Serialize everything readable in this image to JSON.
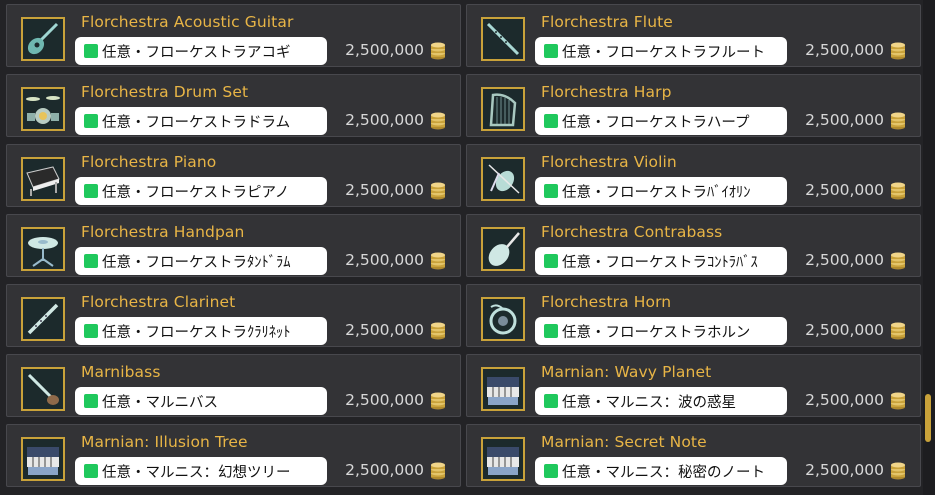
{
  "items": [
    {
      "title": "Florchestra Acoustic Guitar",
      "tag": "任意・フローケストラアコギ",
      "price": "2,500,000",
      "icon": "acoustic-guitar-icon"
    },
    {
      "title": "Florchestra Flute",
      "tag": "任意・フローケストラフルート",
      "price": "2,500,000",
      "icon": "flute-icon"
    },
    {
      "title": "Florchestra Drum Set",
      "tag": "任意・フローケストラドラム",
      "price": "2,500,000",
      "icon": "drum-set-icon"
    },
    {
      "title": "Florchestra Harp",
      "tag": "任意・フローケストラハープ",
      "price": "2,500,000",
      "icon": "harp-icon"
    },
    {
      "title": "Florchestra Piano",
      "tag": "任意・フローケストラピアノ",
      "price": "2,500,000",
      "icon": "piano-icon"
    },
    {
      "title": "Florchestra Violin",
      "tag": "任意・フローケストラﾊﾞｲｵﾘﾝ",
      "price": "2,500,000",
      "icon": "violin-icon"
    },
    {
      "title": "Florchestra Handpan",
      "tag": "任意・フローケストラﾀﾝﾄﾞﾗﾑ",
      "price": "2,500,000",
      "icon": "handpan-icon"
    },
    {
      "title": "Florchestra Contrabass",
      "tag": "任意・フローケストラｺﾝﾄﾗﾊﾞｽ",
      "price": "2,500,000",
      "icon": "contrabass-icon"
    },
    {
      "title": "Florchestra Clarinet",
      "tag": "任意・フローケストラｸﾗﾘﾈｯﾄ",
      "price": "2,500,000",
      "icon": "clarinet-icon"
    },
    {
      "title": "Florchestra Horn",
      "tag": "任意・フローケストラホルン",
      "price": "2,500,000",
      "icon": "horn-icon"
    },
    {
      "title": "Marnibass",
      "tag": "任意・マルニバス",
      "price": "2,500,000",
      "icon": "marnibass-icon"
    },
    {
      "title": "Marnian: Wavy Planet",
      "tag": "任意・マルニス：波の惑星",
      "price": "2,500,000",
      "icon": "keyboard-icon"
    },
    {
      "title": "Marnian: Illusion Tree",
      "tag": "任意・マルニス：幻想ツリー",
      "price": "2,500,000",
      "icon": "keyboard-icon"
    },
    {
      "title": "Marnian: Secret Note",
      "tag": "任意・マルニス：秘密のノート",
      "price": "2,500,000",
      "icon": "keyboard-icon"
    }
  ],
  "colors": {
    "title": "#e8b546",
    "tag_marker": "#1fc85c",
    "card_bg": "#333336",
    "icon_border": "#c9a23a"
  },
  "currency_icon": "gil-coin-stack-icon"
}
